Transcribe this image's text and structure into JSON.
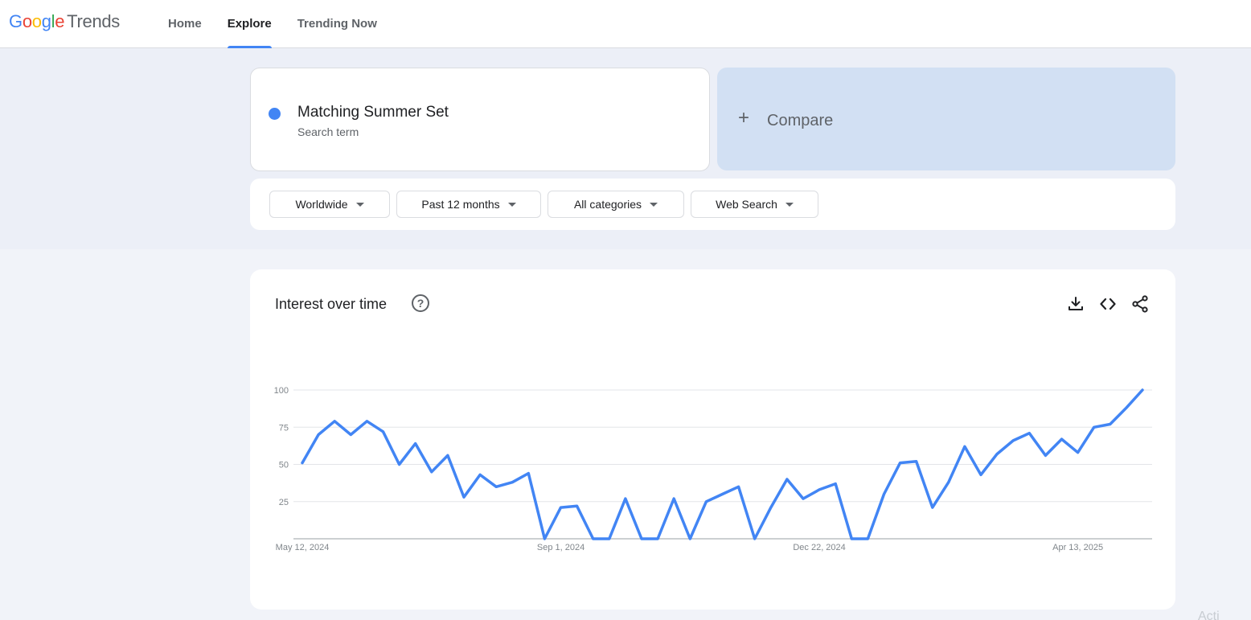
{
  "header": {
    "logo_letters": [
      {
        "char": "G",
        "color": "#4285f4"
      },
      {
        "char": "o",
        "color": "#ea4335"
      },
      {
        "char": "o",
        "color": "#fbbc05"
      },
      {
        "char": "g",
        "color": "#4285f4"
      },
      {
        "char": "l",
        "color": "#34a853"
      },
      {
        "char": "e",
        "color": "#ea4335"
      }
    ],
    "logo_suffix": "Trends",
    "nav": [
      {
        "label": "Home"
      },
      {
        "label": "Explore",
        "active": true
      },
      {
        "label": "Trending Now"
      }
    ]
  },
  "search_term": {
    "name": "Matching Summer Set",
    "subtitle": "Search term",
    "color": "#4285f4"
  },
  "compare": {
    "label": "Compare"
  },
  "filters": [
    {
      "label": "Worldwide"
    },
    {
      "label": "Past 12 months"
    },
    {
      "label": "All categories"
    },
    {
      "label": "Web Search"
    }
  ],
  "chart_panel": {
    "title": "Interest over time",
    "help_symbol": "?"
  },
  "icons": [
    "download-icon",
    "embed-code-icon",
    "share-icon",
    "help-icon"
  ],
  "chart_data": {
    "type": "line",
    "title": "",
    "xlabel": "",
    "ylabel": "",
    "ylim": [
      0,
      100
    ],
    "yticks": [
      25,
      50,
      75,
      100
    ],
    "x_tick_labels": [
      {
        "index": 0,
        "label": "May 12, 2024"
      },
      {
        "index": 16,
        "label": "Sep 1, 2024"
      },
      {
        "index": 32,
        "label": "Dec 22, 2024"
      },
      {
        "index": 48,
        "label": "Apr 13, 2025"
      }
    ],
    "grid": true,
    "series": [
      {
        "name": "Matching Summer Set",
        "color": "#4285f4",
        "values": [
          51,
          70,
          79,
          70,
          79,
          72,
          50,
          64,
          45,
          56,
          28,
          43,
          35,
          38,
          44,
          0,
          21,
          22,
          0,
          0,
          27,
          0,
          0,
          27,
          0,
          25,
          30,
          35,
          0,
          21,
          40,
          27,
          33,
          37,
          0,
          0,
          30,
          51,
          52,
          21,
          38,
          62,
          43,
          57,
          66,
          71,
          56,
          67,
          58,
          75,
          77,
          88,
          100
        ]
      }
    ]
  },
  "watermark": "Acti"
}
